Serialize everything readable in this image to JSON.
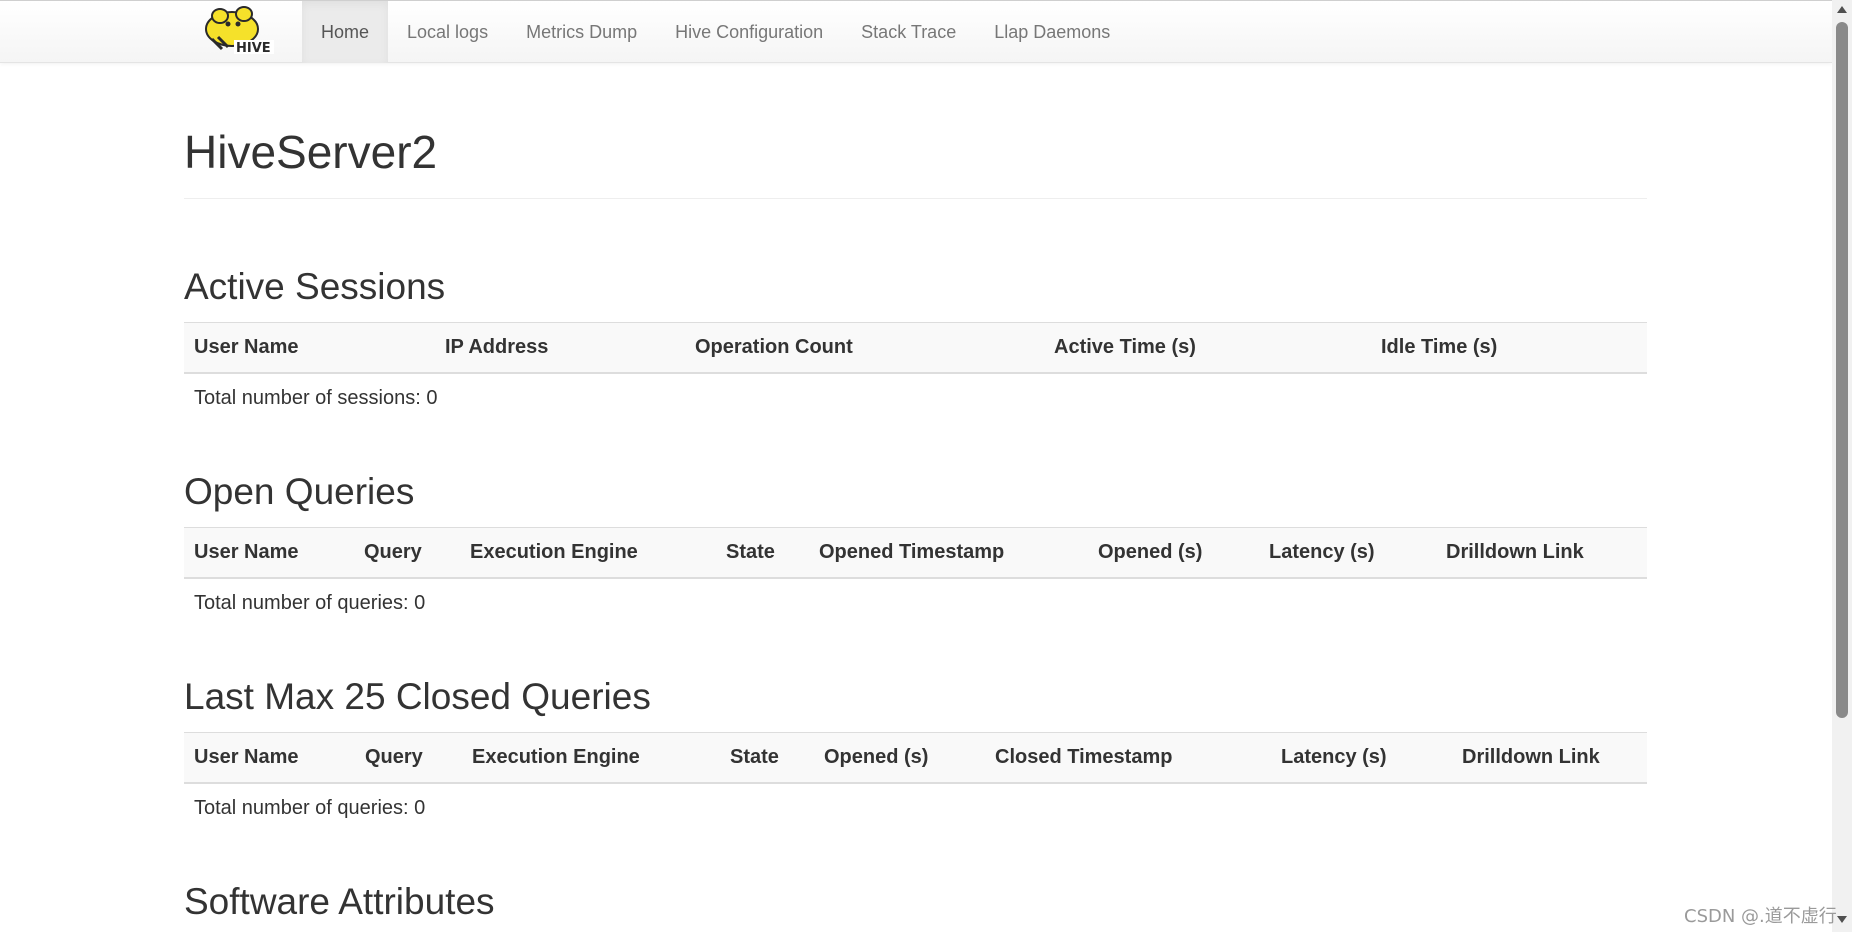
{
  "navbar": {
    "logo_text": "HIVE",
    "items": [
      "Home",
      "Local logs",
      "Metrics Dump",
      "Hive Configuration",
      "Stack Trace",
      "Llap Daemons"
    ],
    "active": "Home"
  },
  "page": {
    "title": "HiveServer2"
  },
  "active_sessions": {
    "heading": "Active Sessions",
    "columns": [
      "User Name",
      "IP Address",
      "Operation Count",
      "Active Time (s)",
      "Idle Time (s)"
    ],
    "footer": "Total number of sessions: 0"
  },
  "open_queries": {
    "heading": "Open Queries",
    "columns": [
      "User Name",
      "Query",
      "Execution Engine",
      "State",
      "Opened Timestamp",
      "Opened (s)",
      "Latency (s)",
      "Drilldown Link"
    ],
    "footer": "Total number of queries: 0"
  },
  "closed_queries": {
    "heading": "Last Max 25 Closed Queries",
    "columns": [
      "User Name",
      "Query",
      "Execution Engine",
      "State",
      "Opened (s)",
      "Closed Timestamp",
      "Latency (s)",
      "Drilldown Link"
    ],
    "footer": "Total number of queries: 0"
  },
  "software_attributes": {
    "heading": "Software Attributes"
  },
  "watermark": "CSDN @.道不虚行",
  "colors": {
    "nav_text": "#777777",
    "nav_active_bg": "#ebebeb",
    "table_header_bg": "#f9f9f9",
    "logo_yellow": "#f5e12a"
  }
}
